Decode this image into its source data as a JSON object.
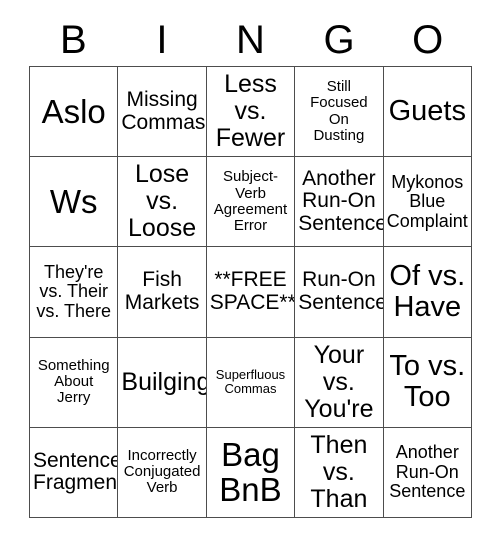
{
  "card": {
    "title": "BINGO",
    "header_letters": [
      "B",
      "I",
      "N",
      "G",
      "O"
    ],
    "grid_size": "5x5",
    "colors": {
      "text": "#000000",
      "border": "#4d4d4d",
      "background": "#ffffff"
    },
    "cells": [
      {
        "row": 1,
        "col": 1,
        "column_letter": "B",
        "text": "Aslo",
        "size": "fs-xxl"
      },
      {
        "row": 1,
        "col": 2,
        "column_letter": "I",
        "text": "Missing\nCommas",
        "size": "fs-md"
      },
      {
        "row": 1,
        "col": 3,
        "column_letter": "N",
        "text": "Less\nvs.\nFewer",
        "size": "fs-lg"
      },
      {
        "row": 1,
        "col": 4,
        "column_letter": "G",
        "text": "Still\nFocused\nOn\nDusting",
        "size": "fs-xs"
      },
      {
        "row": 1,
        "col": 5,
        "column_letter": "O",
        "text": "Guets",
        "size": "fs-xl"
      },
      {
        "row": 2,
        "col": 1,
        "column_letter": "B",
        "text": "Ws",
        "size": "fs-xxl"
      },
      {
        "row": 2,
        "col": 2,
        "column_letter": "I",
        "text": "Lose\nvs.\nLoose",
        "size": "fs-lg"
      },
      {
        "row": 2,
        "col": 3,
        "column_letter": "N",
        "text": "Subject-\nVerb\nAgreement\nError",
        "size": "fs-xs"
      },
      {
        "row": 2,
        "col": 4,
        "column_letter": "G",
        "text": "Another\nRun-On\nSentence",
        "size": "fs-md"
      },
      {
        "row": 2,
        "col": 5,
        "column_letter": "O",
        "text": "Mykonos\nBlue\nComplaint",
        "size": "fs-sm"
      },
      {
        "row": 3,
        "col": 1,
        "column_letter": "B",
        "text": "They're\nvs. Their\nvs. There",
        "size": "fs-sm"
      },
      {
        "row": 3,
        "col": 2,
        "column_letter": "I",
        "text": "Fish\nMarkets",
        "size": "fs-md"
      },
      {
        "row": 3,
        "col": 3,
        "column_letter": "N",
        "text": "**FREE\nSPACE**",
        "size": "fs-md"
      },
      {
        "row": 3,
        "col": 4,
        "column_letter": "G",
        "text": "Run-On\nSentence",
        "size": "fs-md"
      },
      {
        "row": 3,
        "col": 5,
        "column_letter": "O",
        "text": "Of vs.\nHave",
        "size": "fs-xl"
      },
      {
        "row": 4,
        "col": 1,
        "column_letter": "B",
        "text": "Something\nAbout\nJerry",
        "size": "fs-xs"
      },
      {
        "row": 4,
        "col": 2,
        "column_letter": "I",
        "text": "Builging",
        "size": "fs-lg"
      },
      {
        "row": 4,
        "col": 3,
        "column_letter": "N",
        "text": "Superfluous\nCommas",
        "size": "fs-xxs"
      },
      {
        "row": 4,
        "col": 4,
        "column_letter": "G",
        "text": "Your\nvs.\nYou're",
        "size": "fs-lg"
      },
      {
        "row": 4,
        "col": 5,
        "column_letter": "O",
        "text": "To vs.\nToo",
        "size": "fs-xl"
      },
      {
        "row": 5,
        "col": 1,
        "column_letter": "B",
        "text": "Sentence\nFragment",
        "size": "fs-md"
      },
      {
        "row": 5,
        "col": 2,
        "column_letter": "I",
        "text": "Incorrectly\nConjugated\nVerb",
        "size": "fs-xs"
      },
      {
        "row": 5,
        "col": 3,
        "column_letter": "N",
        "text": "Bag\nBnB",
        "size": "fs-xxl"
      },
      {
        "row": 5,
        "col": 4,
        "column_letter": "G",
        "text": "Then\nvs.\nThan",
        "size": "fs-lg"
      },
      {
        "row": 5,
        "col": 5,
        "column_letter": "O",
        "text": "Another\nRun-On\nSentence",
        "size": "fs-sm"
      }
    ]
  }
}
